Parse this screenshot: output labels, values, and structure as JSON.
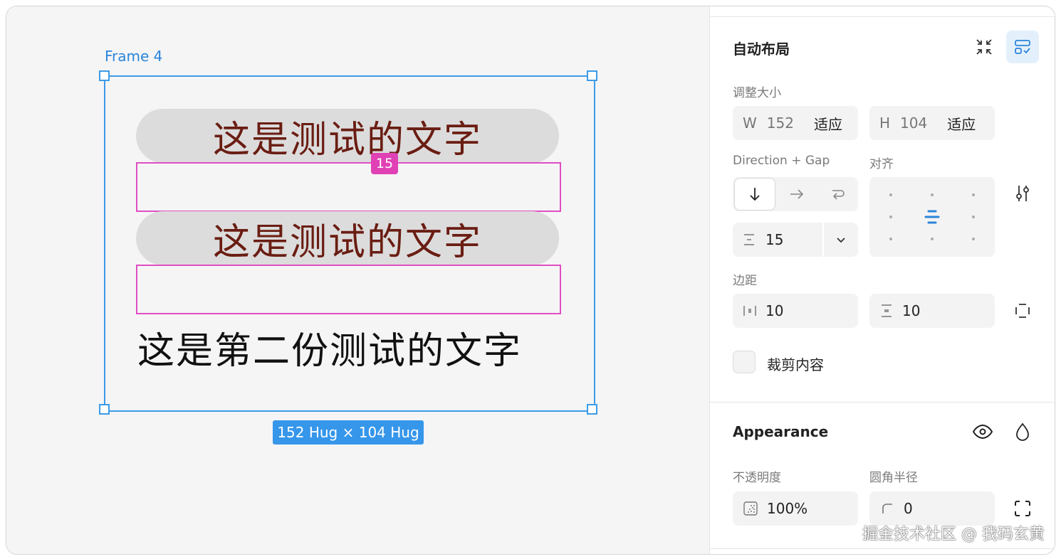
{
  "canvas": {
    "frame_label": "Frame 4",
    "pill_text_1": "这是测试的文字",
    "pill_text_2": "这是测试的文字",
    "plain_text": "这是第二份测试的文字",
    "gap_badge": "15",
    "size_badge": "152 Hug × 104 Hug",
    "colors": {
      "selection": "#3c9be6",
      "gap": "#e04ec2",
      "pill_text": "#6a1d12"
    }
  },
  "auto_layout": {
    "title": "自动布局",
    "resize_label": "调整大小",
    "width_prefix": "W",
    "width_value": "152",
    "width_mode": "适应",
    "height_prefix": "H",
    "height_value": "104",
    "height_mode": "适应",
    "direction_label": "Direction + Gap",
    "align_label": "对齐",
    "gap_value": "15",
    "padding_label": "边距",
    "padding_h": "10",
    "padding_v": "10",
    "clip_label": "裁剪内容",
    "icons": [
      "collapse-icon",
      "auto-layout-icon",
      "arrow-down-icon",
      "arrow-right-icon",
      "wrap-icon",
      "gap-icon",
      "chevron-down-icon",
      "alignment-settings-icon",
      "padding-h-icon",
      "padding-v-icon",
      "padding-individual-icon"
    ]
  },
  "appearance": {
    "title": "Appearance",
    "opacity_label": "不透明度",
    "opacity_value": "100%",
    "radius_label": "圆角半径",
    "radius_value": "0",
    "icons": [
      "eye-icon",
      "drop-icon",
      "opacity-icon",
      "corner-radius-icon",
      "individual-corners-icon"
    ]
  },
  "watermark": "掘金技术社区 @ 我码玄黄"
}
